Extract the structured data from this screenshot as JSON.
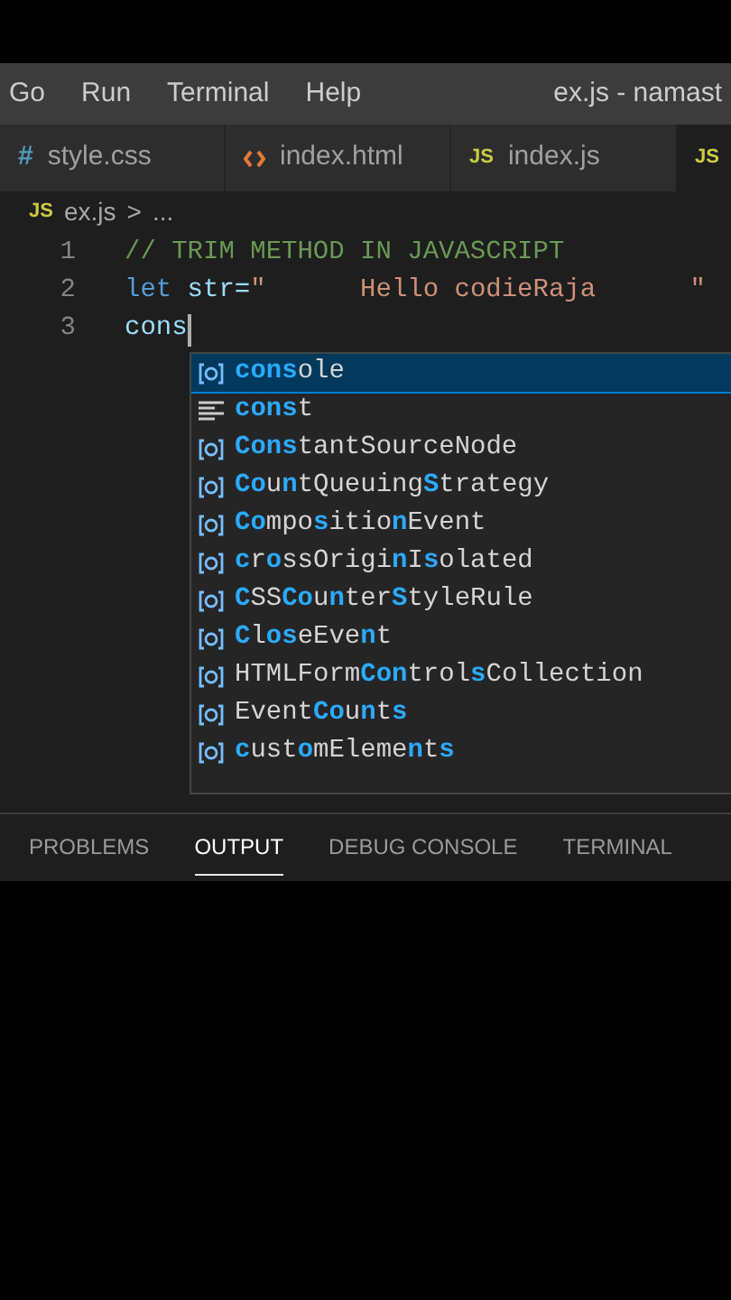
{
  "menu": [
    "Go",
    "Run",
    "Terminal",
    "Help"
  ],
  "window": {
    "title": "ex.js - namast"
  },
  "tabs": [
    {
      "kind": "css",
      "icon": "#",
      "label": "style.css",
      "selected": false
    },
    {
      "kind": "html",
      "label": "index.html",
      "selected": false
    },
    {
      "kind": "js",
      "icon": "JS",
      "label": "index.js",
      "selected": false
    },
    {
      "kind": "js",
      "icon": "JS",
      "selected": true
    }
  ],
  "breadcrumb": {
    "icon": "JS",
    "file": "ex.js",
    "separator": ">",
    "rest": "..."
  },
  "lines": [
    {
      "number": "1",
      "tokens": [
        {
          "kind": "comment",
          "text": "// TRIM METHOD IN JAVASCRIPT"
        }
      ]
    },
    {
      "number": "2",
      "tokens": [
        {
          "kind": "keyword",
          "text": "let"
        },
        {
          "kind": "variable",
          "text": " str="
        },
        {
          "kind": "string",
          "text": "\"      Hello codieRaja      \""
        }
      ]
    },
    {
      "number": "3",
      "tokens": [
        {
          "kind": "plain",
          "text": "cons"
        }
      ],
      "cursor": true
    }
  ],
  "suggestions": [
    {
      "kind": "variable",
      "selected": true,
      "parts": [
        {
          "text": "cons",
          "match": true
        },
        {
          "text": "ole",
          "match": false
        }
      ]
    },
    {
      "kind": "snippet",
      "selected": false,
      "parts": [
        {
          "text": "cons",
          "match": true
        },
        {
          "text": "t",
          "match": false
        }
      ]
    },
    {
      "kind": "variable",
      "selected": false,
      "parts": [
        {
          "text": "Cons",
          "match": true
        },
        {
          "text": "tantSourceNode",
          "match": false
        }
      ]
    },
    {
      "kind": "variable",
      "selected": false,
      "parts": [
        {
          "text": "Co",
          "match": true
        },
        {
          "text": "u",
          "match": false
        },
        {
          "text": "n",
          "match": true
        },
        {
          "text": "tQueuing",
          "match": false
        },
        {
          "text": "S",
          "match": true
        },
        {
          "text": "trategy",
          "match": false
        }
      ]
    },
    {
      "kind": "variable",
      "selected": false,
      "parts": [
        {
          "text": "Co",
          "match": true
        },
        {
          "text": "mpo",
          "match": false
        },
        {
          "text": "s",
          "match": true
        },
        {
          "text": "itio",
          "match": false
        },
        {
          "text": "n",
          "match": true
        },
        {
          "text": "Event",
          "match": false
        }
      ]
    },
    {
      "kind": "variable",
      "selected": false,
      "parts": [
        {
          "text": "c",
          "match": true
        },
        {
          "text": "r",
          "match": false
        },
        {
          "text": "o",
          "match": true
        },
        {
          "text": "ssOrigi",
          "match": false
        },
        {
          "text": "n",
          "match": true
        },
        {
          "text": "I",
          "match": false
        },
        {
          "text": "s",
          "match": true
        },
        {
          "text": "olated",
          "match": false
        }
      ]
    },
    {
      "kind": "variable",
      "selected": false,
      "parts": [
        {
          "text": "C",
          "match": true
        },
        {
          "text": "SS",
          "match": false
        },
        {
          "text": "Co",
          "match": true
        },
        {
          "text": "u",
          "match": false
        },
        {
          "text": "n",
          "match": true
        },
        {
          "text": "ter",
          "match": false
        },
        {
          "text": "S",
          "match": true
        },
        {
          "text": "tyleRule",
          "match": false
        }
      ]
    },
    {
      "kind": "variable",
      "selected": false,
      "parts": [
        {
          "text": "C",
          "match": true
        },
        {
          "text": "l",
          "match": false
        },
        {
          "text": "os",
          "match": true
        },
        {
          "text": "eEve",
          "match": false
        },
        {
          "text": "n",
          "match": true
        },
        {
          "text": "t",
          "match": false
        }
      ]
    },
    {
      "kind": "variable",
      "selected": false,
      "parts": [
        {
          "text": "HTMLForm",
          "match": false
        },
        {
          "text": "Con",
          "match": true
        },
        {
          "text": "trol",
          "match": false
        },
        {
          "text": "s",
          "match": true
        },
        {
          "text": "Collection",
          "match": false
        }
      ]
    },
    {
      "kind": "variable",
      "selected": false,
      "parts": [
        {
          "text": "Event",
          "match": false
        },
        {
          "text": "Co",
          "match": true
        },
        {
          "text": "u",
          "match": false
        },
        {
          "text": "n",
          "match": true
        },
        {
          "text": "t",
          "match": false
        },
        {
          "text": "s",
          "match": true
        }
      ]
    },
    {
      "kind": "variable",
      "selected": false,
      "parts": [
        {
          "text": "c",
          "match": true
        },
        {
          "text": "ust",
          "match": false
        },
        {
          "text": "o",
          "match": true
        },
        {
          "text": "mEleme",
          "match": false
        },
        {
          "text": "n",
          "match": true
        },
        {
          "text": "t",
          "match": false
        },
        {
          "text": "s",
          "match": true
        }
      ]
    }
  ],
  "panel_tabs": [
    {
      "label": "PROBLEMS",
      "selected": false
    },
    {
      "label": "OUTPUT",
      "selected": true
    },
    {
      "label": "DEBUG CONSOLE",
      "selected": false
    },
    {
      "label": "TERMINAL",
      "selected": false
    }
  ]
}
